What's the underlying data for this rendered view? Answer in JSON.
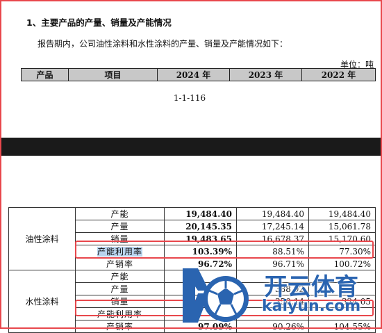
{
  "top": {
    "heading": "1、主要产品的产量、销量及产能情况",
    "intro": "报告期内，公司油性涂料和水性涂料的产量、销量及产能情况如下：",
    "unit": "单位：吨",
    "headers": [
      "产品",
      "项目",
      "2024 年",
      "2023 年",
      "2022 年"
    ],
    "page_number": "1-1-116"
  },
  "bottom": {
    "groups": [
      {
        "category": "油性涂料",
        "rows": [
          {
            "item": "产能",
            "v2024": "19,484.40",
            "v2023": "19,484.40",
            "v2022": "19,484.40"
          },
          {
            "item": "产量",
            "v2024": "20,145.35",
            "v2023": "17,245.14",
            "v2022": "15,061.78"
          },
          {
            "item": "销量",
            "v2024": "19,483.65",
            "v2023": "16,678.37",
            "v2022": "15,170.60"
          },
          {
            "item": "产能利用率",
            "v2024": "103.39%",
            "v2023": "88.51%",
            "v2022": "77.30%"
          },
          {
            "item": "产销率",
            "v2024": "96.72%",
            "v2023": "96.71%",
            "v2022": "100.72%"
          }
        ]
      },
      {
        "category": "水性涂料",
        "rows": [
          {
            "item": "产能",
            "v2024": "",
            "v2023": "",
            "v2022": ""
          },
          {
            "item": "产量",
            "v2024": "",
            "v2023": "388.92",
            "v2022": ""
          },
          {
            "item": "销量",
            "v2024": "",
            "v2023": "350.14",
            "v2022": "324.05"
          },
          {
            "item": "产能利用率",
            "v2024": "",
            "v2023": "",
            "v2022": ""
          },
          {
            "item": "产销率",
            "v2024": "97.09%",
            "v2023": "90.26%",
            "v2022": "104.55%"
          }
        ]
      }
    ]
  },
  "watermark": {
    "text_cn": "开云体育",
    "text_en": "kaiyun.com"
  },
  "colors": {
    "highlight_box": "#e8474c",
    "header_bg": "#c8c8c8",
    "watermark_blue": "#2a64b0",
    "selection": "#b9d4ee"
  }
}
